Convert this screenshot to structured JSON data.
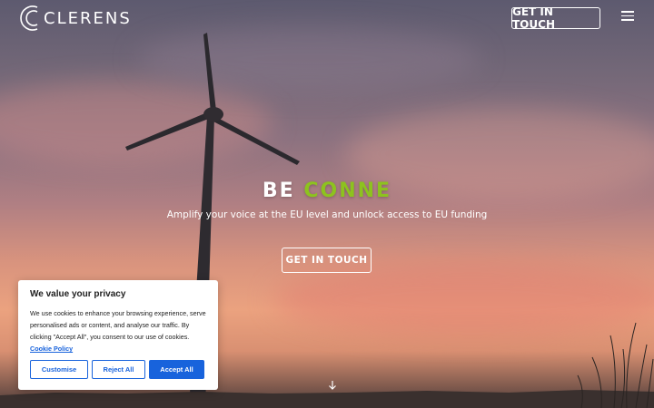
{
  "header": {
    "logo_text": "CLERENS",
    "cta_label": "GET IN TOUCH",
    "menu_icon": "hamburger-menu-icon"
  },
  "hero": {
    "headline_prefix": "BE ",
    "headline_accent": "CONNE",
    "subtitle": "Amplify your voice at the EU level and unlock access to EU funding",
    "cta_label": "GET IN TOUCH",
    "scroll_icon": "arrow-down-icon"
  },
  "cookie_banner": {
    "title": "We value your privacy",
    "body": "We use cookies to enhance your browsing experience, serve personalised ads or content, and analyse our traffic. By clicking \"Accept All\", you consent to our use of cookies.",
    "policy_link": "Cookie Policy",
    "buttons": {
      "customise": "Customise",
      "reject": "Reject All",
      "accept": "Accept All"
    }
  },
  "colors": {
    "accent_green": "#8dc21f",
    "cookie_blue": "#1863dc",
    "text_white": "#ffffff"
  }
}
